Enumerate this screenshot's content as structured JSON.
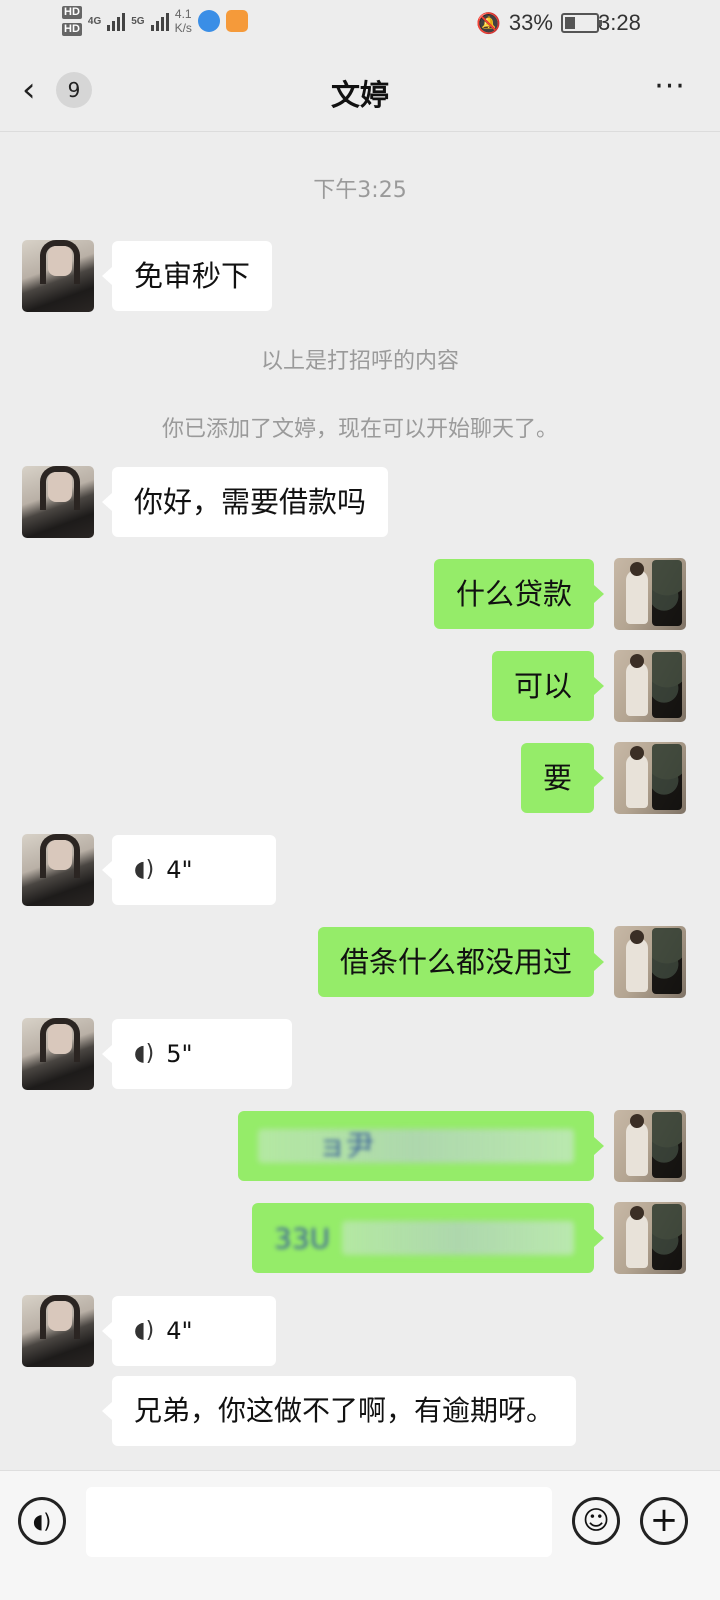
{
  "status_bar": {
    "hd1": "HD",
    "hd2": "HD",
    "net1": "4G",
    "net2": "5G",
    "speed_value": "4.1",
    "speed_unit": "K/s",
    "battery_percent": "33%",
    "battery_level": 0.33,
    "time": "3:28"
  },
  "nav": {
    "back_icon": "chevron-left-icon",
    "unread_count": "9",
    "title": "文婷",
    "more_icon": "more-icon"
  },
  "chat": {
    "timestamp": "下午3:25",
    "greeting_notice": "以上是打招呼的内容",
    "added_notice": "你已添加了文婷，现在可以开始聊天了。",
    "messages": [
      {
        "from": "other",
        "type": "text",
        "text": "免审秒下"
      },
      {
        "from": "other",
        "type": "text",
        "text": "你好，需要借款吗"
      },
      {
        "from": "self",
        "type": "text",
        "text": "什么贷款"
      },
      {
        "from": "self",
        "type": "text",
        "text": "可以"
      },
      {
        "from": "self",
        "type": "text",
        "text": "要"
      },
      {
        "from": "other",
        "type": "voice",
        "text": "4\""
      },
      {
        "from": "self",
        "type": "text",
        "text": "借条什么都没用过"
      },
      {
        "from": "other",
        "type": "voice",
        "text": "5\""
      },
      {
        "from": "self",
        "type": "redacted",
        "text": "ョ尹"
      },
      {
        "from": "self",
        "type": "redacted",
        "text": "33U"
      },
      {
        "from": "other",
        "type": "voice",
        "text": "4\""
      },
      {
        "from": "other",
        "type": "text",
        "text": "兄弟，你这做不了啊，有逾期呀。"
      }
    ]
  },
  "input_bar": {
    "voice_icon": "voice-toggle-icon",
    "emoji_icon": "emoji-icon",
    "plus_icon": "plus-icon",
    "voice_glyph": "◖)",
    "emoji_glyph": "☺",
    "plus_glyph": "+"
  },
  "colors": {
    "background": "#ededed",
    "bubble_self": "#95ec69",
    "bubble_other": "#ffffff"
  }
}
